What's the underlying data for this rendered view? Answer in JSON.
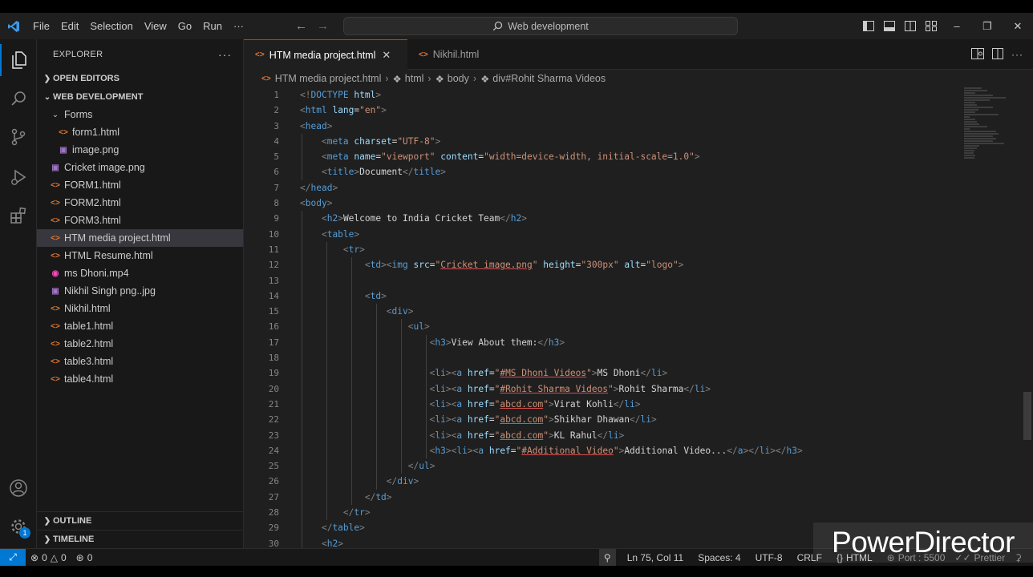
{
  "menu": [
    "File",
    "Edit",
    "Selection",
    "View",
    "Go",
    "Run",
    "···"
  ],
  "search": {
    "label": "Web development"
  },
  "sidebar": {
    "title": "EXPLORER",
    "open_editors": "OPEN EDITORS",
    "workspace": "WEB DEVELOPMENT",
    "folder": "Forms",
    "items": [
      {
        "name": "form1.html",
        "type": "html",
        "indent": 2
      },
      {
        "name": "image.png",
        "type": "img",
        "indent": 2
      },
      {
        "name": "Cricket image.png",
        "type": "img",
        "indent": 1
      },
      {
        "name": "FORM1.html",
        "type": "html",
        "indent": 1
      },
      {
        "name": "FORM2.html",
        "type": "html",
        "indent": 1
      },
      {
        "name": "FORM3.html",
        "type": "html",
        "indent": 1
      },
      {
        "name": "HTM media project.html",
        "type": "html",
        "indent": 1,
        "selected": true
      },
      {
        "name": "HTML Resume.html",
        "type": "html",
        "indent": 1
      },
      {
        "name": "ms Dhoni.mp4",
        "type": "mp4",
        "indent": 1
      },
      {
        "name": "Nikhil Singh png..jpg",
        "type": "img",
        "indent": 1
      },
      {
        "name": "Nikhil.html",
        "type": "html",
        "indent": 1
      },
      {
        "name": "table1.html",
        "type": "html",
        "indent": 1
      },
      {
        "name": "table2.html",
        "type": "html",
        "indent": 1
      },
      {
        "name": "table3.html",
        "type": "html",
        "indent": 1
      },
      {
        "name": "table4.html",
        "type": "html",
        "indent": 1
      }
    ],
    "outline": "OUTLINE",
    "timeline": "TIMELINE"
  },
  "tabs": [
    {
      "label": "HTM media project.html",
      "active": true
    },
    {
      "label": "Nikhil.html",
      "active": false
    }
  ],
  "breadcrumb": [
    "HTM media project.html",
    "html",
    "body",
    "div#Rohit Sharma Videos"
  ],
  "line_numbers": [
    "1",
    "2",
    "3",
    "4",
    "5",
    "6",
    "7",
    "8",
    "9",
    "10",
    "11",
    "12",
    "13",
    "14",
    "15",
    "16",
    "17",
    "18",
    "19",
    "20",
    "21",
    "22",
    "23",
    "24",
    "25",
    "26",
    "27",
    "28",
    "29",
    "30"
  ],
  "status": {
    "errors": "0",
    "warnings": "0",
    "ports": "0",
    "position": "Ln 75, Col 11",
    "spaces": "Spaces: 4",
    "encoding": "UTF-8",
    "eol": "CRLF",
    "language": "HTML",
    "port": "Port : 5500",
    "prettier": "Prettier"
  },
  "notification_badge": "1",
  "watermark": "PowerDirector",
  "colors": {
    "accent": "#0078d4",
    "tag": "#569cd6",
    "attr": "#9cdcfe",
    "string": "#ce9178"
  }
}
